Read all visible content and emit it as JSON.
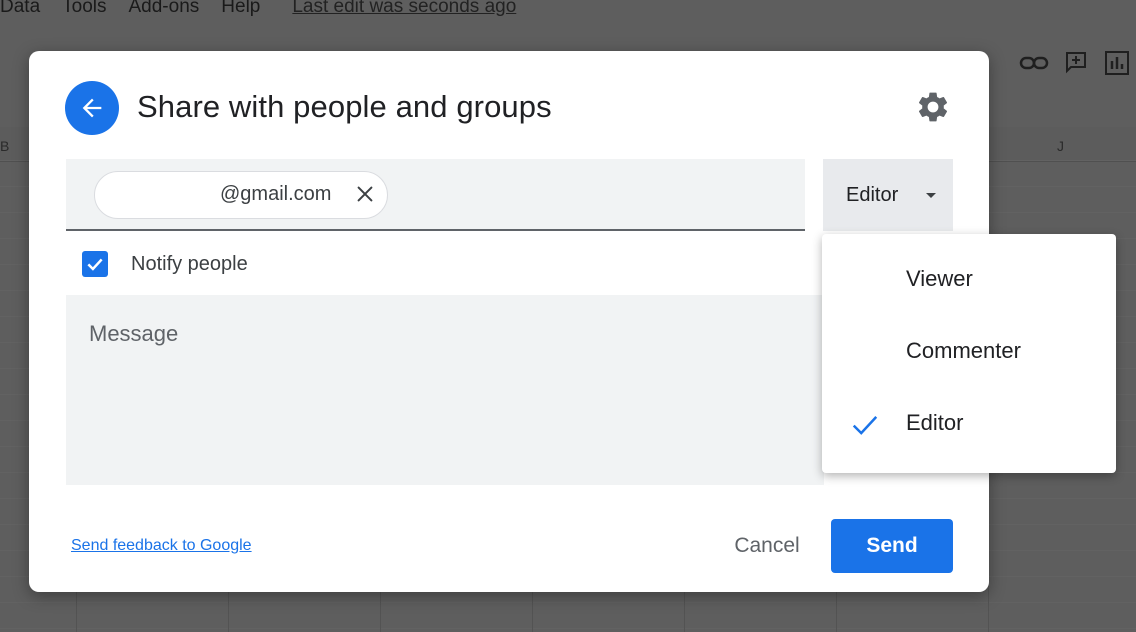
{
  "menubar": {
    "items": [
      "Data",
      "Tools",
      "Add-ons",
      "Help"
    ],
    "last_edit": "Last edit was seconds ago"
  },
  "grid": {
    "column_letter": "J",
    "column_letter_left": "B"
  },
  "dialog": {
    "title": "Share with people and groups",
    "recipient_email": "@gmail.com",
    "role_selected": "Editor",
    "notify_label": "Notify people",
    "notify_checked": true,
    "message_placeholder": "Message",
    "feedback_link": "Send feedback to Google",
    "cancel_label": "Cancel",
    "send_label": "Send"
  },
  "role_menu": {
    "items": [
      {
        "label": "Viewer",
        "selected": false
      },
      {
        "label": "Commenter",
        "selected": false
      },
      {
        "label": "Editor",
        "selected": true
      }
    ]
  },
  "colors": {
    "accent": "#1a73e8",
    "text_primary": "#202124",
    "text_secondary": "#5f6368",
    "field_bg": "#f1f3f4"
  },
  "icons": {
    "back": "arrow-left-icon",
    "settings": "gear-icon",
    "remove_chip": "close-icon",
    "role_caret": "caret-down-icon",
    "checkbox": "checkmark-icon",
    "menu_check": "checkmark-icon"
  }
}
